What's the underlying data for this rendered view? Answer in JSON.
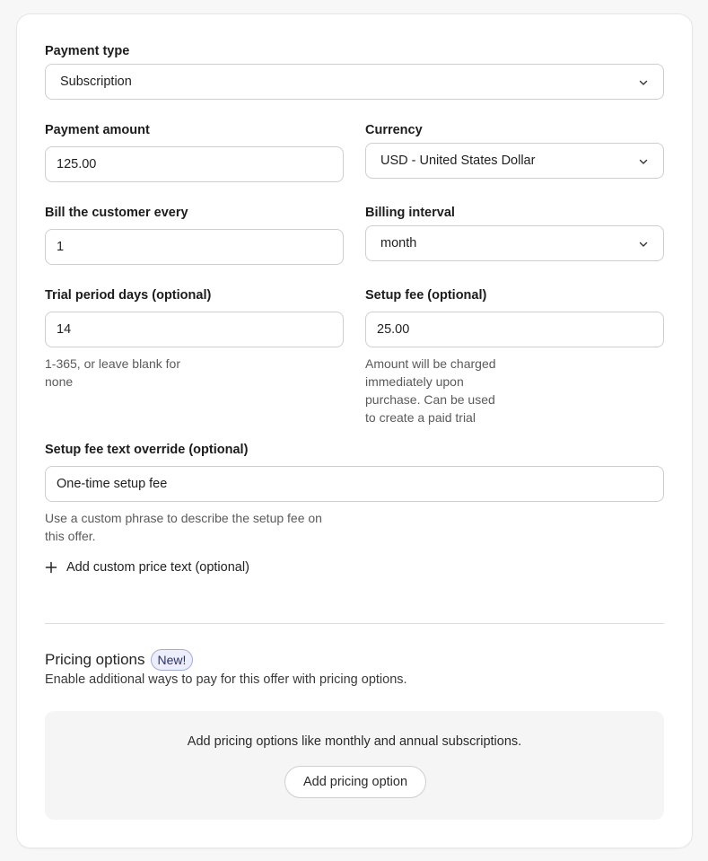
{
  "form": {
    "payment_type": {
      "label": "Payment type",
      "value": "Subscription",
      "icon": "chevron-down-icon"
    },
    "payment_amount": {
      "label": "Payment amount",
      "value": "125.00"
    },
    "currency": {
      "label": "Currency",
      "value": "USD - United States Dollar",
      "icon": "chevron-down-icon"
    },
    "bill_every": {
      "label": "Bill the customer every",
      "value": "1"
    },
    "billing_interval": {
      "label": "Billing interval",
      "value": "month",
      "icon": "chevron-down-icon"
    },
    "trial_days": {
      "label": "Trial period days (optional)",
      "value": "14",
      "help_lines": [
        "1-365, or leave blank for",
        "none"
      ]
    },
    "setup_fee": {
      "label": "Setup fee (optional)",
      "value": "25.00",
      "help_lines": [
        "Amount will be charged",
        "immediately upon",
        "purchase. Can be used",
        "to create a paid trial"
      ]
    },
    "setup_fee_text": {
      "label": "Setup fee text override (optional)",
      "value": "One-time setup fee",
      "help_lines": [
        "Use a custom phrase to describe the setup fee on",
        "this offer."
      ]
    },
    "add_custom_price": {
      "label": "Add custom price text (optional)",
      "icon": "plus-icon"
    }
  },
  "pricing_options": {
    "title": "Pricing options",
    "badge": "New!",
    "description": "Enable additional ways to pay for this offer with pricing options.",
    "empty_text": "Add pricing options like monthly and annual subscriptions.",
    "button": "Add pricing option"
  },
  "colors": {
    "badge_bg": "#eceefb",
    "badge_border": "#a7acd6",
    "badge_text": "#2d3170",
    "input_border": "#cfcfcf",
    "empty_box_bg": "#f5f5f5"
  }
}
